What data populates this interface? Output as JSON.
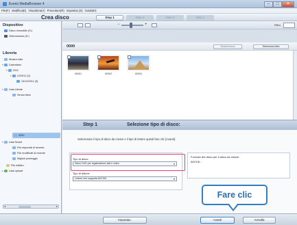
{
  "window": {
    "title": "Everio MediaBrowser 4",
    "controls": {
      "minimize": "–",
      "maximize": "□",
      "close": "✕"
    }
  },
  "menu": [
    "File(F)",
    "Modifica(E)",
    "Visualizza(V)",
    "Procedure(R)",
    "Impostaz.(S)",
    "Guida(H)"
  ],
  "header": {
    "title": "Crea disco",
    "steps": [
      "Step 1",
      "Step 2",
      "Step 3",
      "Step 4"
    ]
  },
  "toolbar": {
    "zoom_minus": "−",
    "zoom_plus": "+",
    "filter_label": "Filtro"
  },
  "sidebar": {
    "devices_title": "Dispositivo",
    "devices": [
      "Disco rimovibile (G:)",
      "Videocamera (H:)"
    ],
    "library_title": "Libreria",
    "library": [
      "Mostra tutto",
      "Calendario",
      "2011",
      "12/2011 (3)",
      "13/12/2011 (3)",
      "Lista Utente",
      "Senza titolo",
      "0000",
      "Lista Smart",
      "File importati di recente",
      "File modificati di recente",
      "Migliori punteggio",
      "File editato",
      "Lista upload"
    ],
    "scroll_left": "◂",
    "scroll_right": "▸"
  },
  "content": {
    "folder_title": "0000",
    "deselect_label": "Deseleziona",
    "select_all_label": "Seleziona tutto",
    "thumbnails": [
      {
        "label": "00001"
      },
      {
        "label": "00002"
      },
      {
        "label": "00004"
      }
    ]
  },
  "step_panel": {
    "step_label": "Step 1",
    "step_title": "Selezione tipo di disco:",
    "instruction": "Selezionare il tipo di disco da creare e il tipo di lettore quindi fare clic [Avanti].",
    "disc_type_label": "Tipo di disco:",
    "disc_type_value": "Disco DVD per registrazione dati e video",
    "player_type_label": "Tipo di lettore:",
    "player_type_value": "Lettore che supporta AVCHD",
    "format_label": "Formato del disco per il disco da creare:",
    "format_value": "AVCHD",
    "dropdown_glyph": "▾"
  },
  "callout": {
    "text": "Fare clic"
  },
  "footer": {
    "settings_label": "Impostaz.",
    "next_label": "Avanti",
    "cancel_label": "Annulla"
  },
  "colors": {
    "highlight": "#e03d7e",
    "callout_border": "#2e7cc4",
    "selection": "#9ec4ec"
  }
}
